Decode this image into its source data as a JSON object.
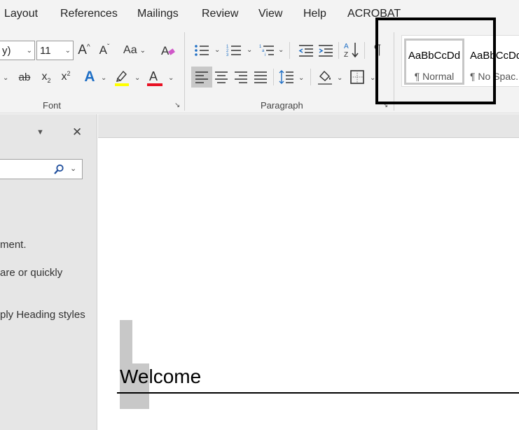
{
  "ribbon_tabs": [
    "Layout",
    "References",
    "Mailings",
    "Review",
    "View",
    "Help",
    "ACROBAT"
  ],
  "font_group": {
    "font_name": "y)",
    "font_size": "11",
    "grow_font": "A",
    "shrink_font": "A",
    "change_case": "Aa",
    "strikethrough": "ab",
    "subscript": "x",
    "superscript": "x",
    "subscript_mark": "2",
    "superscript_mark": "2",
    "text_effects": "A",
    "font_color": "A",
    "label": "Font",
    "highlight_color": "#ffff00",
    "font_color_value": "#e81123"
  },
  "paragraph_group": {
    "label": "Paragraph",
    "pilcrow": "¶"
  },
  "styles_gallery": {
    "items": [
      {
        "sample": "AaBbCcDd",
        "name": "¶ Normal",
        "selected": true
      },
      {
        "sample": "AaBbCcDd",
        "name": "¶ No Spac."
      }
    ]
  },
  "nav_pane": {
    "close": "✕",
    "texts": [
      "ment.",
      "are or quickly",
      "ply Heading styles"
    ]
  },
  "document": {
    "heading": "Welcome"
  },
  "colors": {
    "ribbon_bg": "#f3f3f3",
    "pane_bg": "#e6e6e6",
    "accent_blue": "#185abd"
  }
}
